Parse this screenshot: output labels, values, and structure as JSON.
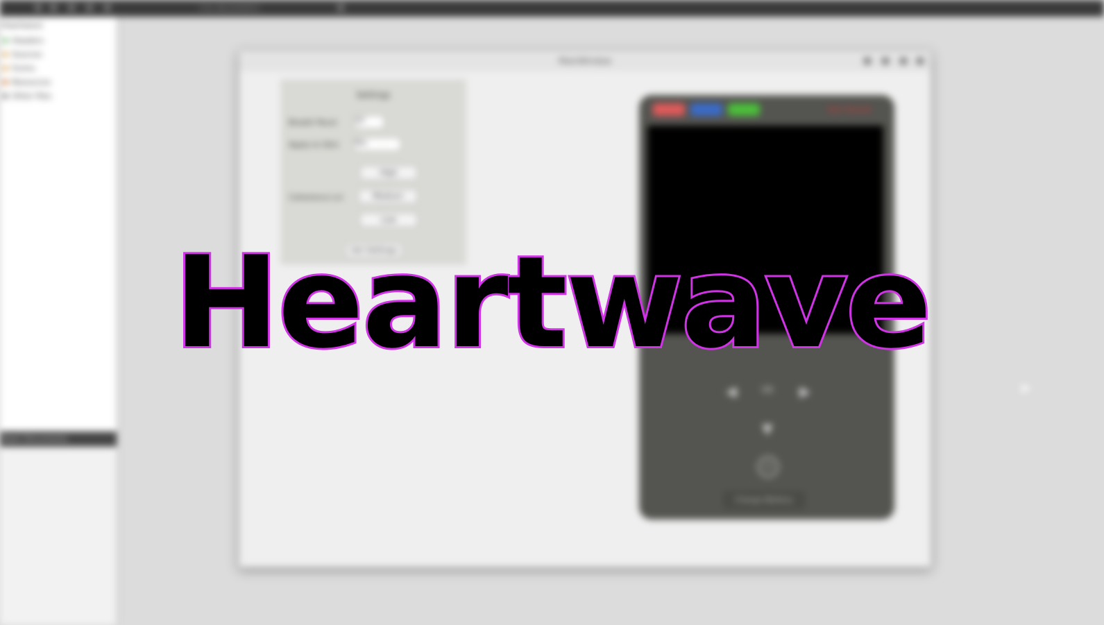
{
  "topbar": {
    "document_label": "<no document>"
  },
  "project_pane": {
    "title": "Heartwave",
    "items": [
      {
        "label": "Headers",
        "color": "#6db36d"
      },
      {
        "label": "Sources",
        "color": "#d9a04a"
      },
      {
        "label": "Forms",
        "color": "#d9a04a"
      },
      {
        "label": "Resources",
        "color": "#c9732e"
      },
      {
        "label": "Other files",
        "color": "#6d6d6d"
      }
    ]
  },
  "open_documents": {
    "label": "Open Documents"
  },
  "main_window": {
    "title": "MainWindow",
    "settings": {
      "title": "Settings",
      "breath_pacer_label": "Breath Pacer",
      "breath_pacer_value": "10",
      "apply_label": "Apply to Skin",
      "apply_value": "Yes",
      "coherence_label": "Coherence Lvl",
      "levels": [
        "High",
        "Medium",
        "Low"
      ],
      "set_button": "Set Settings"
    },
    "device": {
      "button_colors": [
        "#e05a5a",
        "#3a6bc9",
        "#4bbf3a"
      ],
      "status_text": "Not Paired",
      "ok_label": "OK",
      "charge_button": "Charge Battery"
    }
  },
  "overlay": {
    "title": "Heartwave",
    "fill_color": "#000000",
    "stroke_color": "#d033e6"
  }
}
